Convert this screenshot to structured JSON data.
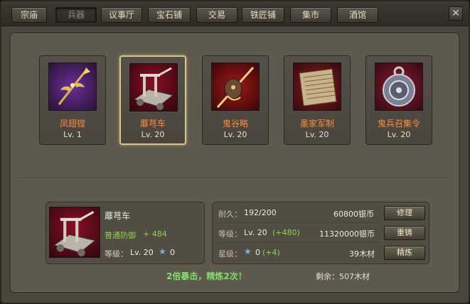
{
  "tabs": [
    "宗庙",
    "兵器",
    "议事厅",
    "宝石铺",
    "交易",
    "铁匠铺",
    "集市",
    "酒馆"
  ],
  "active_tab": "兵器",
  "items": [
    {
      "name": "凤翅镗",
      "level": "Lv. 1",
      "icon": "golden-halberd-icon"
    },
    {
      "name": "蘼芎车",
      "level": "Lv. 20",
      "icon": "siege-ballista-cart-icon"
    },
    {
      "name": "鬼谷略",
      "level": "Lv. 20",
      "icon": "gourd-staff-icon"
    },
    {
      "name": "墨家军制",
      "level": "Lv. 20",
      "icon": "bamboo-scroll-icon"
    },
    {
      "name": "鬼兵召集令",
      "level": "Lv. 20",
      "icon": "ghost-token-icon"
    }
  ],
  "selected": {
    "name": "蘼芎车",
    "stat_label": "普通防御",
    "stat_value": "+ 484",
    "level_label": "等级：",
    "level": "Lv. 20",
    "star_count": "0"
  },
  "details": {
    "durability_label": "耐久：",
    "durability": "192/200",
    "repair_cost": "60800银币",
    "repair_button": "修理",
    "level_label": "等级：",
    "level": "Lv. 20",
    "level_bonus": "(+480)",
    "recast_cost": "11320000银币",
    "recast_button": "重铸",
    "star_label": "星级：",
    "star": "0",
    "star_bonus": "(+4)",
    "refine_cost": "39木材",
    "refine_button": "精炼"
  },
  "crit_message": "2倍暴击，精炼2次！",
  "remaining": "剩余：507木材",
  "colors": {
    "item_name": "#ff8a3c",
    "stat_green": "#8fd14f",
    "crit_green": "#7fe06a",
    "frame_gold": "#d9c58a"
  }
}
